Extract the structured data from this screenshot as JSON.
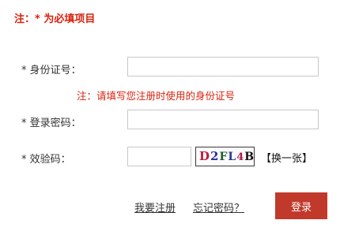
{
  "note": {
    "text": "注：* 为必填项目"
  },
  "fields": {
    "id_card": {
      "label": "* 身份证号：",
      "value": "",
      "hint": "注：请填写您注册时使用的身份证号"
    },
    "password": {
      "label": "* 登录密码：",
      "value": ""
    },
    "captcha": {
      "label": "* 效验码：",
      "value": "",
      "image_chars": [
        "D",
        "2",
        "F",
        "L",
        "4",
        "B"
      ],
      "refresh_label": "【换一张】"
    }
  },
  "actions": {
    "register_label": "我要注册",
    "forgot_label": "忘记密码？",
    "login_label": "登录"
  },
  "colors": {
    "accent_red": "#d9230f",
    "button_red": "#c0392b"
  }
}
